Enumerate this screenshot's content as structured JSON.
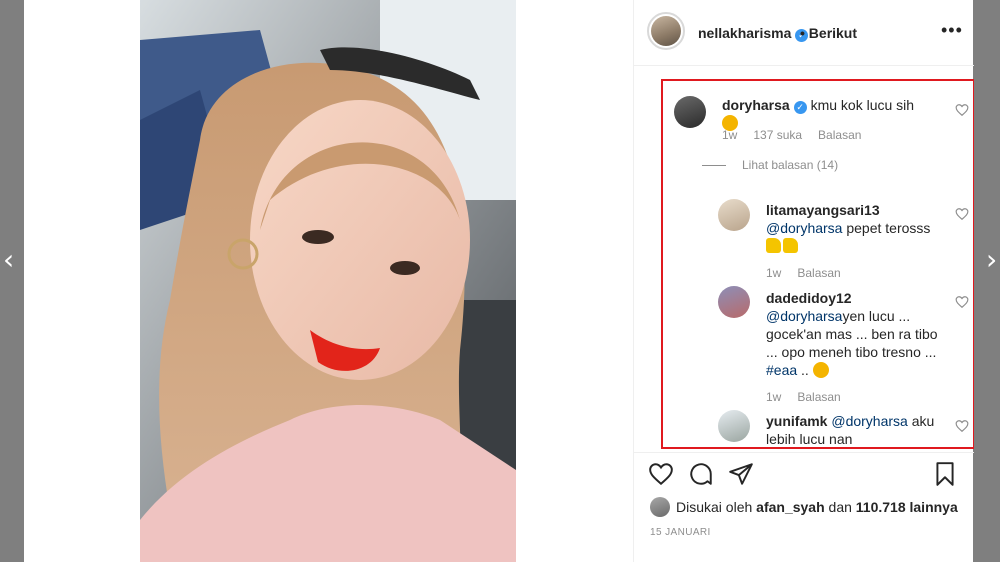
{
  "nav": {
    "prev_glyph": "‹",
    "next_glyph": "›"
  },
  "header": {
    "username": "nellakharisma",
    "verified_glyph": "✓",
    "follow_status": "• Berikut",
    "more_glyph": "•••"
  },
  "comments": [
    {
      "username": "doryharsa",
      "verified": true,
      "text": "kmu kok lucu sih",
      "time": "1w",
      "likes": "137 suka",
      "reply": "Balasan"
    }
  ],
  "view_replies": "Lihat balasan (14)",
  "replies": [
    {
      "username": "litamayangsari13",
      "mention": "@doryharsa",
      "text": " pepet terosss",
      "time": "1w",
      "reply": "Balasan"
    },
    {
      "username": "dadedidoy12",
      "mention": "@doryharsa",
      "text": "yen lucu ... gocek'an mas ... ben ra tibo ... opo meneh tibo tresno ... ",
      "hashtag": "#eaa",
      "text_end": " ..",
      "time": "1w",
      "reply": "Balasan"
    },
    {
      "username": "yunifamk",
      "mention": "@doryharsa",
      "text": " aku lebih lucu nan"
    }
  ],
  "likes": {
    "prefix": "Disukai oleh ",
    "user": "afan_syah",
    "middle": " dan ",
    "count": "110.718 lainnya"
  },
  "date": "15 JANUARI",
  "colors": {
    "highlight": "#e0191f",
    "verified": "#3897f0",
    "mention": "#003569"
  }
}
